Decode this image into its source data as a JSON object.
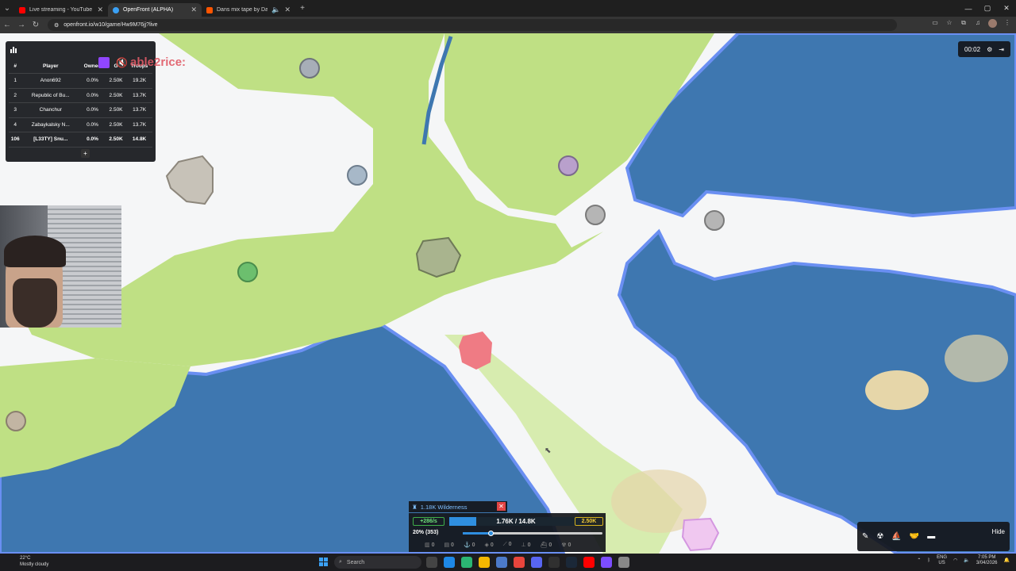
{
  "browser": {
    "tabs": [
      {
        "title": "Live streaming - YouTube Studio",
        "icon": "youtube-icon",
        "color": "#ff0000"
      },
      {
        "title": "OpenFront (ALPHA)",
        "icon": "openfront-icon",
        "color": "#3ba1f5"
      },
      {
        "title": "Dans mix tape by Daniel D",
        "icon": "soundcloud-icon",
        "color": "#ff5500"
      }
    ],
    "url": "openfront.io/w10/game/Hw9M76jj?live"
  },
  "leaderboard": {
    "headers": [
      "#",
      "Player",
      "Owned",
      "G",
      "Troops"
    ],
    "rows": [
      {
        "rank": "1",
        "player": "Anon692",
        "owned": "0.0%",
        "gold": "2.50K",
        "troops": "19.2K"
      },
      {
        "rank": "2",
        "player": "Republic of Bu...",
        "owned": "0.0%",
        "gold": "2.50K",
        "troops": "13.7K"
      },
      {
        "rank": "3",
        "player": "Chanchur",
        "owned": "0.0%",
        "gold": "2.50K",
        "troops": "13.7K"
      },
      {
        "rank": "4",
        "player": "Zabaykalsky N...",
        "owned": "0.0%",
        "gold": "2.50K",
        "troops": "13.7K"
      },
      {
        "rank": "106",
        "player": "[L33TY] Snu...",
        "owned": "0.0%",
        "gold": "2.50K",
        "troops": "14.8K"
      }
    ],
    "more_label": "+"
  },
  "stream_overlay": {
    "tag": "able2rice:"
  },
  "timer": {
    "time": "00:02"
  },
  "bottom_panel": {
    "title": "1.18K Wilderness",
    "rate": "+286/s",
    "troops": "1.76K / 14.8K",
    "troop_fill": 0.2,
    "gold": "2.50K",
    "attack_ratio": "20% (353)",
    "attack_ratio_value": 0.2,
    "unit_counts": [
      "0",
      "0",
      "0",
      "0",
      "0",
      "0",
      "0",
      "0"
    ]
  },
  "build_bar": {
    "hide_label": "Hide"
  },
  "taskbar": {
    "weather_temp": "22°C",
    "weather_desc": "Mostly cloudy",
    "search_placeholder": "Search",
    "lang": "ENG",
    "region": "US",
    "time": "7:05 PM",
    "date": "3/04/2026"
  },
  "colors": {
    "ocean": "#3e77b0",
    "grass": "#bfe084",
    "snow": "#f5f6f7",
    "sand": "#e6d6a9"
  }
}
